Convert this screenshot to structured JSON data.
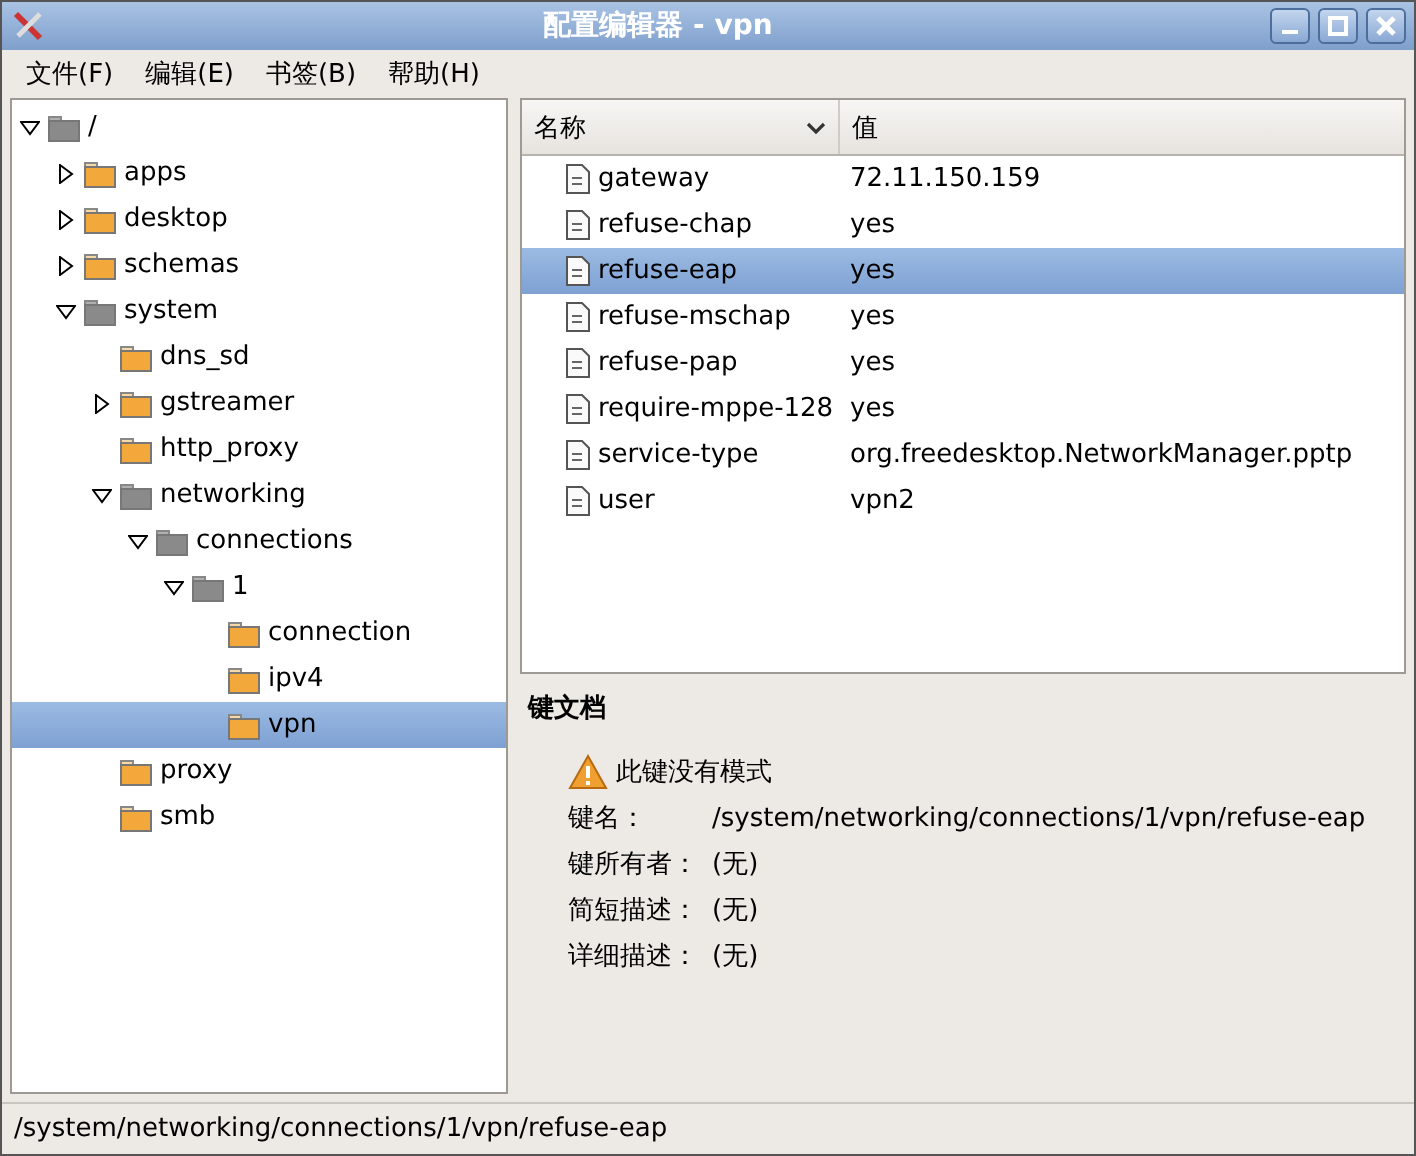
{
  "window": {
    "title": "配置编辑器 - vpn"
  },
  "menu": [
    "文件(F)",
    "编辑(E)",
    "书签(B)",
    "帮助(H)"
  ],
  "tree": [
    {
      "label": "/",
      "kind": "branch",
      "expanded": true,
      "selected": false,
      "children": [
        {
          "label": "apps",
          "kind": "branch",
          "expanded": false,
          "selected": false
        },
        {
          "label": "desktop",
          "kind": "branch",
          "expanded": false,
          "selected": false
        },
        {
          "label": "schemas",
          "kind": "branch",
          "expanded": false,
          "selected": false
        },
        {
          "label": "system",
          "kind": "branch",
          "expanded": true,
          "selected": false,
          "children": [
            {
              "label": "dns_sd",
              "kind": "leaf",
              "selected": false
            },
            {
              "label": "gstreamer",
              "kind": "branch",
              "expanded": false,
              "selected": false
            },
            {
              "label": "http_proxy",
              "kind": "leaf",
              "selected": false
            },
            {
              "label": "networking",
              "kind": "branch",
              "expanded": true,
              "selected": false,
              "children": [
                {
                  "label": "connections",
                  "kind": "branch",
                  "expanded": true,
                  "selected": false,
                  "children": [
                    {
                      "label": "1",
                      "kind": "branch",
                      "expanded": true,
                      "selected": false,
                      "children": [
                        {
                          "label": "connection",
                          "kind": "leaf",
                          "selected": false
                        },
                        {
                          "label": "ipv4",
                          "kind": "leaf",
                          "selected": false
                        },
                        {
                          "label": "vpn",
                          "kind": "leaf",
                          "selected": true
                        }
                      ]
                    }
                  ]
                }
              ]
            },
            {
              "label": "proxy",
              "kind": "leaf",
              "selected": false
            },
            {
              "label": "smb",
              "kind": "leaf",
              "selected": false
            }
          ]
        }
      ]
    }
  ],
  "table": {
    "columns": [
      "名称",
      "值"
    ],
    "rows": [
      {
        "name": "gateway",
        "value": "72.11.150.159",
        "selected": false
      },
      {
        "name": "refuse-chap",
        "value": "yes",
        "selected": false
      },
      {
        "name": "refuse-eap",
        "value": "yes",
        "selected": true
      },
      {
        "name": "refuse-mschap",
        "value": "yes",
        "selected": false
      },
      {
        "name": "refuse-pap",
        "value": "yes",
        "selected": false
      },
      {
        "name": "require-mppe-128",
        "value": "yes",
        "selected": false
      },
      {
        "name": "service-type",
        "value": "org.freedesktop.NetworkManager.pptp",
        "selected": false
      },
      {
        "name": "user",
        "value": "vpn2",
        "selected": false
      }
    ]
  },
  "docs": {
    "title": "键文档",
    "warning": "此键没有模式",
    "fields": [
      {
        "label": "键名：",
        "value": "/system/networking/connections/1/vpn/refuse-eap"
      },
      {
        "label": "键所有者：",
        "value": "(无)"
      },
      {
        "label": "简短描述：",
        "value": "(无)"
      },
      {
        "label": "详细描述：",
        "value": "(无)"
      }
    ]
  },
  "status_bar": "/system/networking/connections/1/vpn/refuse-eap"
}
